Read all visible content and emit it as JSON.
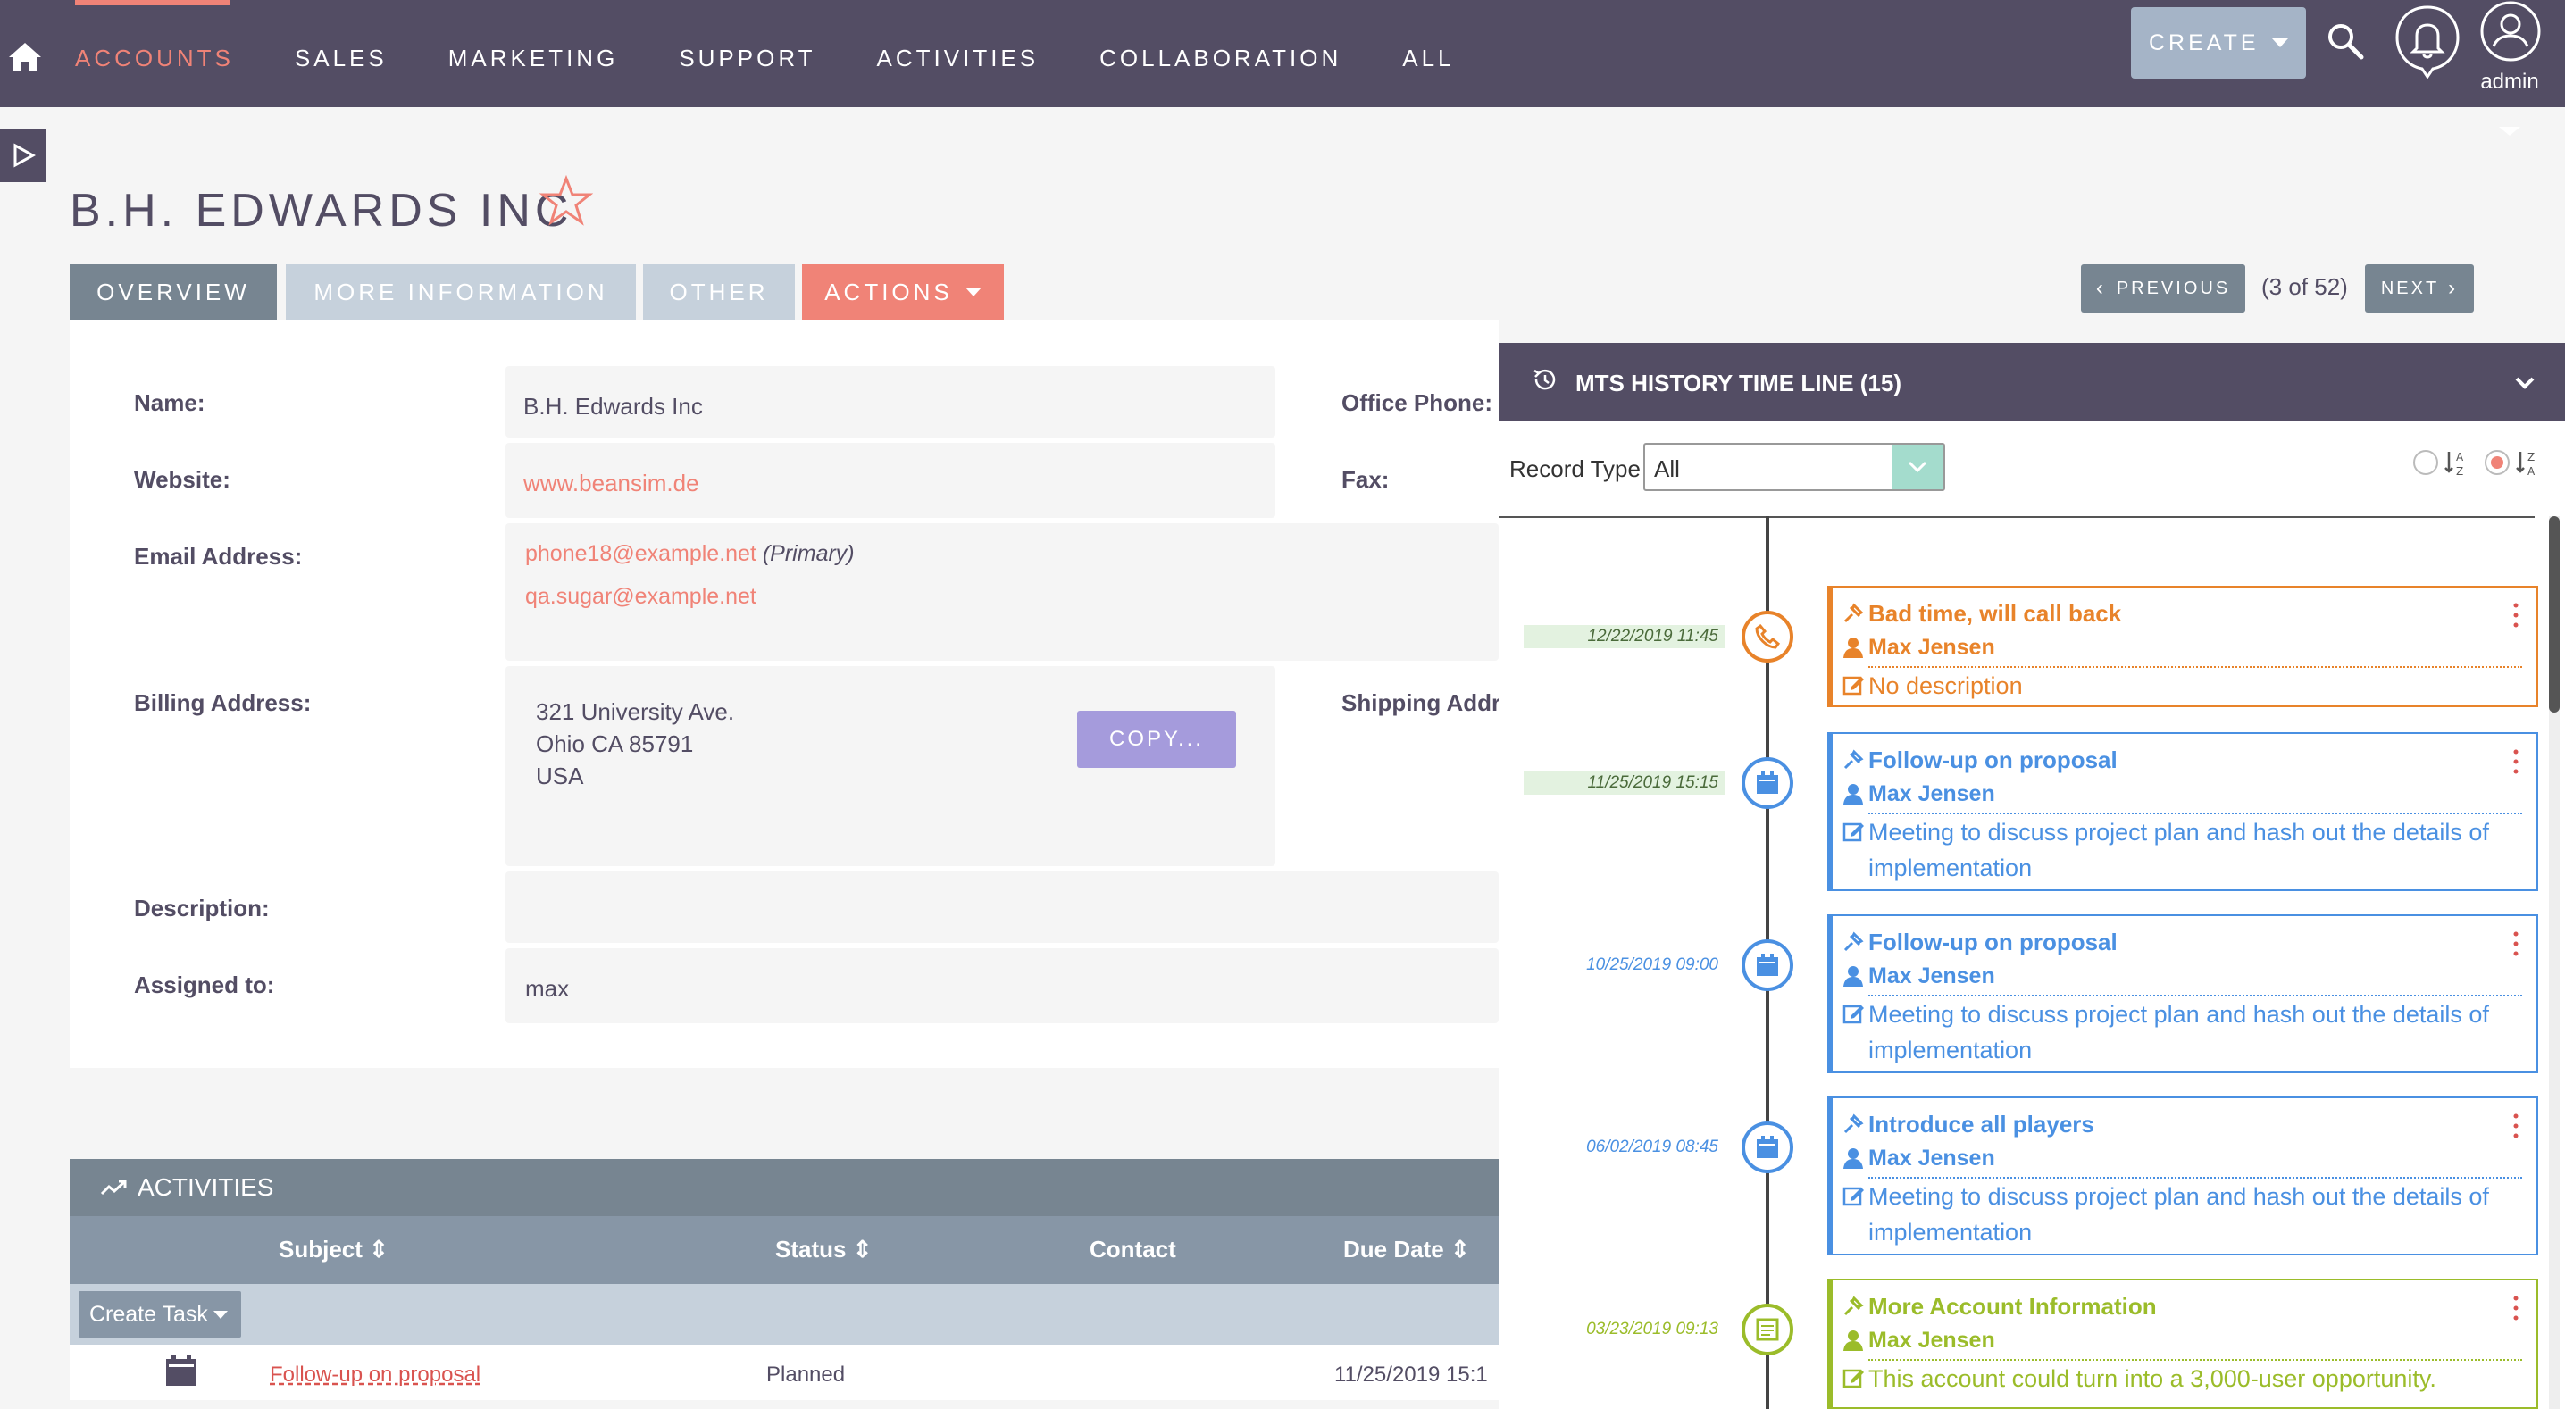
{
  "nav": {
    "items": [
      "ACCOUNTS",
      "SALES",
      "MARKETING",
      "SUPPORT",
      "ACTIVITIES",
      "COLLABORATION",
      "ALL"
    ],
    "create_label": "CREATE",
    "user_label": "admin",
    "accent": "#f08377",
    "bg": "#534d64"
  },
  "record": {
    "title": "B.H. EDWARDS INC",
    "tabs": [
      "OVERVIEW",
      "MORE INFORMATION",
      "OTHER",
      "ACTIONS"
    ],
    "pager": {
      "previous": "PREVIOUS",
      "count": "(3 of 52)",
      "next": "NEXT"
    }
  },
  "fields": {
    "name_label": "Name:",
    "name_value": "B.H. Edwards Inc",
    "website_label": "Website:",
    "website_value": "www.beansim.de",
    "email_label": "Email Address:",
    "email_primary": "phone18@example.net",
    "email_primary_tag": "(Primary)",
    "email_secondary": "qa.sugar@example.net",
    "billing_label": "Billing Address:",
    "billing_line1": "321 University Ave.",
    "billing_line2": "Ohio CA  85791",
    "billing_line3": "USA",
    "copy_label": "COPY...",
    "description_label": "Description:",
    "assigned_label": "Assigned to:",
    "assigned_value": "max",
    "office_phone_label": "Office Phone:",
    "fax_label": "Fax:",
    "shipping_label": "Shipping Addr"
  },
  "activities": {
    "title": "ACTIVITIES",
    "columns": [
      "Subject",
      "Status",
      "Contact",
      "Due Date"
    ],
    "create_task": "Create Task",
    "rows": [
      {
        "subject": "Follow-up on proposal",
        "status": "Planned",
        "contact": "",
        "due": "11/25/2019 15:1"
      }
    ]
  },
  "timeline": {
    "title": "MTS HISTORY TIME LINE (15)",
    "record_type_label": "Record Type",
    "record_type_value": "All",
    "entries": [
      {
        "date": "12/22/2019 11:45",
        "subject": "Bad time, will call back",
        "user": "Max Jensen",
        "desc": "No description",
        "kind": "call",
        "color": "#e8832a",
        "date_bg": "#e3f2e0",
        "date_color": "#4a6a3a"
      },
      {
        "date": "11/25/2019 15:15",
        "subject": "Follow-up on proposal",
        "user": "Max Jensen",
        "desc": "Meeting to discuss project plan and hash out the details of implementation",
        "kind": "meeting",
        "color": "#4a90e2",
        "date_bg": "#e3f2e0",
        "date_color": "#4a6a3a"
      },
      {
        "date": "10/25/2019 09:00",
        "subject": "Follow-up on proposal",
        "user": "Max Jensen",
        "desc": "Meeting to discuss project plan and hash out the details of implementation",
        "kind": "meeting",
        "color": "#4a90e2",
        "date_bg": "transparent",
        "date_color": "#4a90e2"
      },
      {
        "date": "06/02/2019 08:45",
        "subject": "Introduce all players",
        "user": "Max Jensen",
        "desc": "Meeting to discuss project plan and hash out the details of implementation",
        "kind": "meeting",
        "color": "#4a90e2",
        "date_bg": "transparent",
        "date_color": "#4a90e2"
      },
      {
        "date": "03/23/2019 09:13",
        "subject": "More Account Information",
        "user": "Max Jensen",
        "desc": "This account could turn into a 3,000-user opportunity.",
        "kind": "note",
        "color": "#9bbc2a",
        "date_bg": "transparent",
        "date_color": "#9bbc2a"
      }
    ]
  }
}
